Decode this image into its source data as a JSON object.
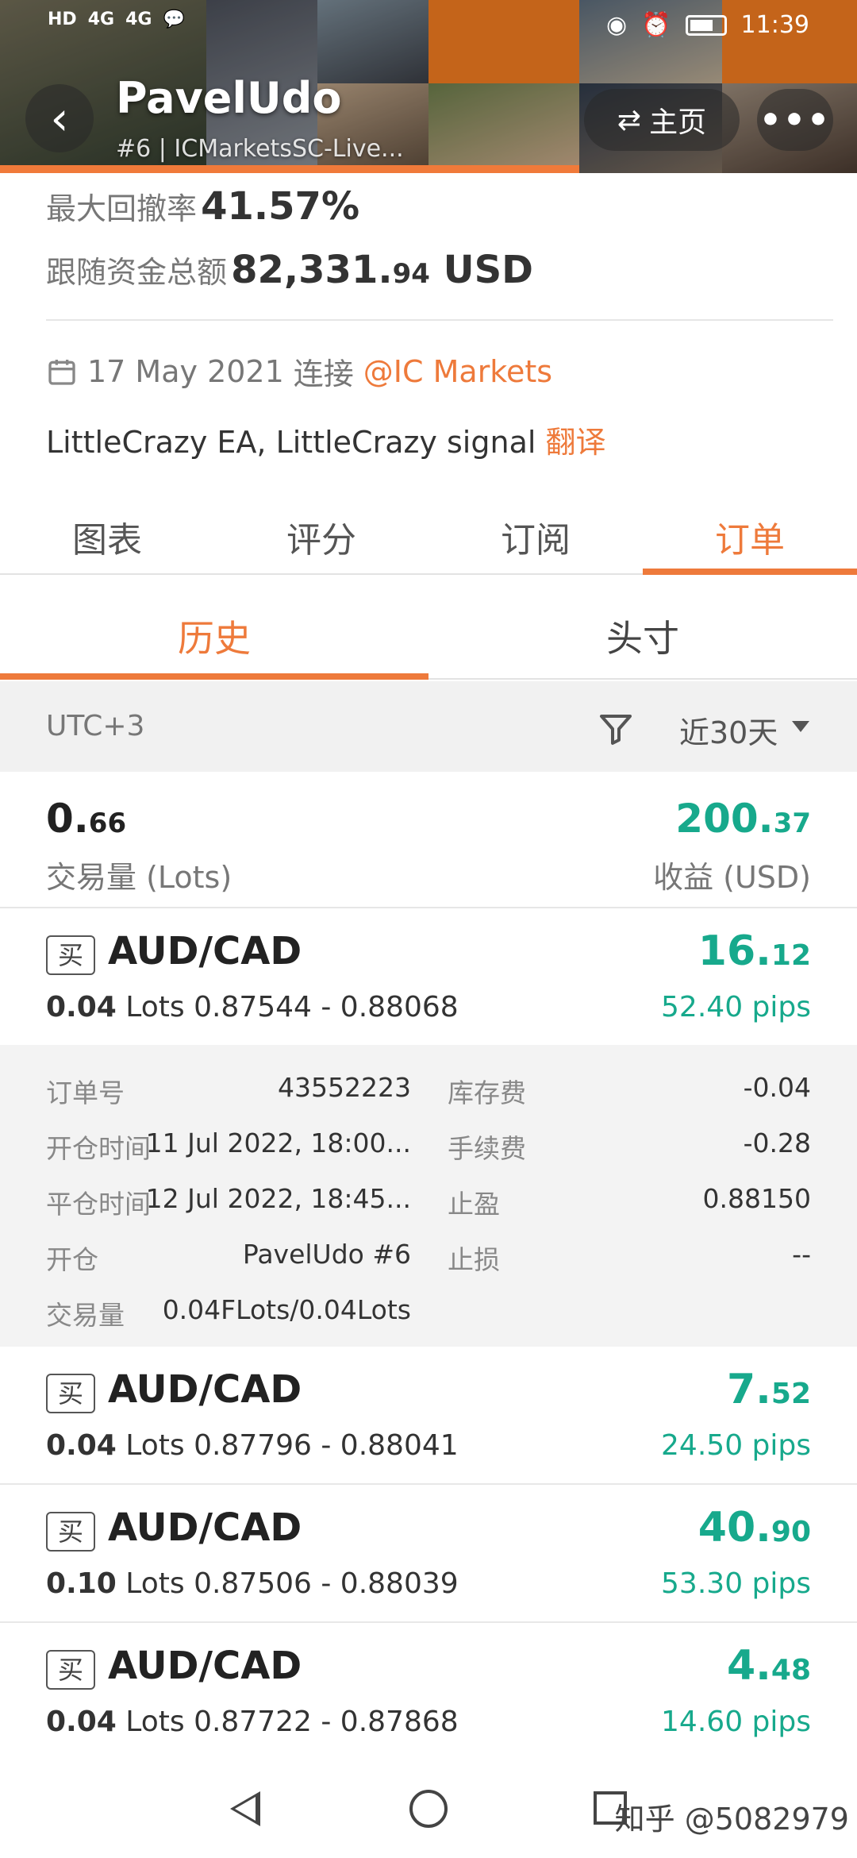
{
  "status_bar": {
    "signal_labels": [
      "HD",
      "4G",
      "4G"
    ],
    "time": "11:39"
  },
  "header": {
    "title": "PavelUdo",
    "subtitle": "#6 | ICMarketsSC-Live...",
    "home_label": "主页",
    "more_label": "•••",
    "back_glyph": "‹",
    "home_glyph": "⇄"
  },
  "stats": {
    "drawdown_label": "最大回撤率",
    "drawdown_value": "41.57%",
    "funds_label": "跟随资金总额",
    "funds_value_main": "82,331.",
    "funds_value_frac": "94",
    "funds_currency": "USD"
  },
  "connection": {
    "date": "17 May 2021",
    "connect_word": "连接",
    "broker": "@IC Markets"
  },
  "description": {
    "text": "LittleCrazy EA, LittleCrazy signal",
    "translate": "翻译"
  },
  "tabs": [
    {
      "label": "图表"
    },
    {
      "label": "评分"
    },
    {
      "label": "订阅"
    },
    {
      "label": "订单"
    }
  ],
  "subtabs": [
    {
      "label": "历史"
    },
    {
      "label": "头寸"
    }
  ],
  "filter": {
    "timezone": "UTC+3",
    "range": "近30天"
  },
  "summary": {
    "volume_main": "0.",
    "volume_frac": "66",
    "volume_label": "交易量 (Lots)",
    "profit_main": "200.",
    "profit_frac": "37",
    "profit_label": "收益 (USD)"
  },
  "orders": [
    {
      "side": "买",
      "pair": "AUD/CAD",
      "lots": "0.04",
      "lots_unit": "Lots",
      "prices": "0.87544 - 0.88068",
      "profit_main": "16.",
      "profit_frac": "12",
      "pips": "52.40 pips"
    },
    {
      "side": "买",
      "pair": "AUD/CAD",
      "lots": "0.04",
      "lots_unit": "Lots",
      "prices": "0.87796 - 0.88041",
      "profit_main": "7.",
      "profit_frac": "52",
      "pips": "24.50 pips"
    },
    {
      "side": "买",
      "pair": "AUD/CAD",
      "lots": "0.10",
      "lots_unit": "Lots",
      "prices": "0.87506 - 0.88039",
      "profit_main": "40.",
      "profit_frac": "90",
      "pips": "53.30 pips"
    },
    {
      "side": "买",
      "pair": "AUD/CAD",
      "lots": "0.04",
      "lots_unit": "Lots",
      "prices": "0.87722 - 0.87868",
      "profit_main": "4.",
      "profit_frac": "48",
      "pips": "14.60 pips"
    }
  ],
  "order_detail": {
    "order_no_label": "订单号",
    "order_no": "43552223",
    "swap_label": "库存费",
    "swap": "-0.04",
    "open_time_label": "开仓时间",
    "open_time": "11 Jul 2022, 18:00...",
    "commission_label": "手续费",
    "commission": "-0.28",
    "close_time_label": "平仓时间",
    "close_time": "12 Jul 2022, 18:45...",
    "tp_label": "止盈",
    "tp": "0.88150",
    "open_label": "开仓",
    "open_by": "PavelUdo  #6",
    "sl_label": "止损",
    "sl": "--",
    "volume_label": "交易量",
    "volume": "0.04FLots/0.04Lots"
  },
  "watermark": "知乎 @5082979",
  "colors": {
    "accent": "#ee7a3b",
    "profit": "#17a98c"
  }
}
